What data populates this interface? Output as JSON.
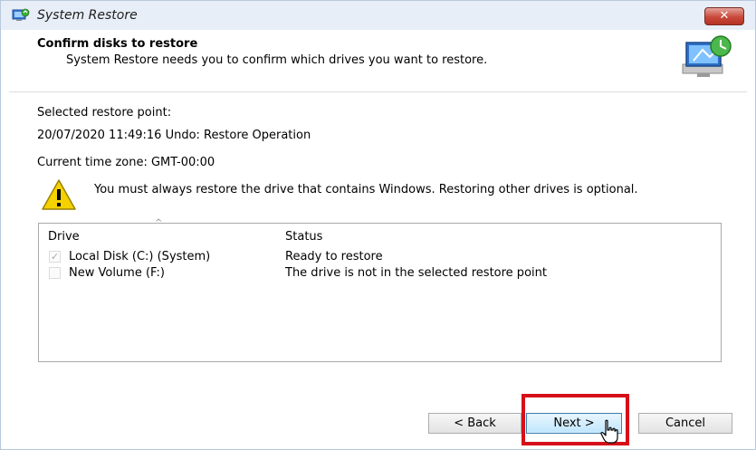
{
  "window": {
    "title": "System Restore",
    "close_glyph": "✕",
    "icon": "system-restore-icon"
  },
  "header": {
    "title": "Confirm disks to restore",
    "subtitle": "System Restore needs you to confirm which drives you want to restore.",
    "icon": "computer-restore-icon"
  },
  "body": {
    "restore_point_label": "Selected restore point:",
    "restore_point_value": "20/07/2020 11:49:16 Undo: Restore Operation",
    "timezone": "Current time zone: GMT-00:00",
    "warning_icon": "warning-triangle-icon",
    "warning_text": "You must always restore the drive that contains Windows. Restoring other drives is optional."
  },
  "drive_list": {
    "columns": [
      "Drive",
      "Status"
    ],
    "rows": [
      {
        "drive": "Local Disk (C:) (System)",
        "status": "Ready to restore",
        "checked": true
      },
      {
        "drive": "New Volume (F:)",
        "status": "The drive is not in the selected restore point",
        "checked": false
      }
    ]
  },
  "buttons": {
    "back": "< Back",
    "next": "Next >",
    "cancel": "Cancel"
  },
  "colors": {
    "highlight": "#d6101a",
    "title_bar": "#e8eef7",
    "close_button": "#c9493a"
  }
}
